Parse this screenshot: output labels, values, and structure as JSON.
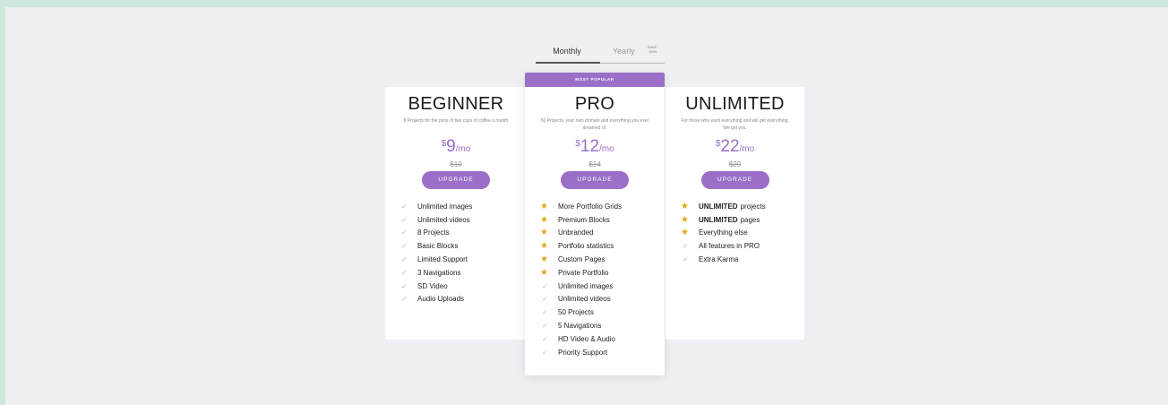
{
  "toggle": {
    "monthly_label": "Monthly",
    "yearly_label": "Yearly",
    "save_badge_line1": "SAVE",
    "save_badge_line2": "~20%"
  },
  "plans": {
    "beginner": {
      "title": "BEGINNER",
      "description": "8 Projects for the price of two cups of coffee a month",
      "currency": "$",
      "price": "9",
      "period": "/mo",
      "old_price": "$10",
      "button": "UPGRADE",
      "features": [
        {
          "icon": "check-icon",
          "text": "Unlimited images"
        },
        {
          "icon": "check-icon",
          "text": "Unlimited videos"
        },
        {
          "icon": "check-icon",
          "text": "8 Projects"
        },
        {
          "icon": "check-icon",
          "text": "Basic Blocks"
        },
        {
          "icon": "check-icon",
          "text": "Limited Support"
        },
        {
          "icon": "check-icon",
          "text": "3 Navigations"
        },
        {
          "icon": "check-icon",
          "text": "SD Video"
        },
        {
          "icon": "check-icon",
          "text": "Audio Uploads"
        }
      ]
    },
    "pro": {
      "ribbon": "MOST POPULAR",
      "title": "PRO",
      "description": "50 Projects, your own domain and everything you ever dreamed of.",
      "currency": "$",
      "price": "12",
      "period": "/mo",
      "old_price": "$14",
      "button": "UPGRADE",
      "features": [
        {
          "icon": "star-icon",
          "text": "More Portfolio Grids"
        },
        {
          "icon": "star-icon",
          "text": "Premium Blocks"
        },
        {
          "icon": "star-icon",
          "text": "Unbranded"
        },
        {
          "icon": "star-icon",
          "text": "Portfolio statistics"
        },
        {
          "icon": "star-icon",
          "text": "Custom Pages"
        },
        {
          "icon": "star-icon",
          "text": "Private Portfolio"
        },
        {
          "icon": "check-icon",
          "text": "Unlimited images"
        },
        {
          "icon": "check-icon",
          "text": "Unlimited videos"
        },
        {
          "icon": "check-icon",
          "text": "50 Projects"
        },
        {
          "icon": "check-icon",
          "text": "5 Navigations"
        },
        {
          "icon": "check-icon",
          "text": "HD Video & Audio"
        },
        {
          "icon": "check-icon",
          "text": "Priority Support"
        }
      ]
    },
    "unlimited": {
      "title": "UNLIMITED",
      "description": "For those who want everything and will get everything. We got you.",
      "currency": "$",
      "price": "22",
      "period": "/mo",
      "old_price": "$29",
      "button": "UPGRADE",
      "features": [
        {
          "icon": "star-icon",
          "bold": "UNLIMITED",
          "text": "projects"
        },
        {
          "icon": "star-icon",
          "bold": "UNLIMITED",
          "text": "pages"
        },
        {
          "icon": "star-icon",
          "text": "Everything else"
        },
        {
          "icon": "check-icon",
          "text": "All features in PRO"
        },
        {
          "icon": "check-icon",
          "text": "Extra Karma"
        }
      ]
    }
  },
  "colors": {
    "accent": "#9b6fc7",
    "star": "#e2a818",
    "background": "#eff0f3",
    "frame": "#cfe8dc"
  }
}
